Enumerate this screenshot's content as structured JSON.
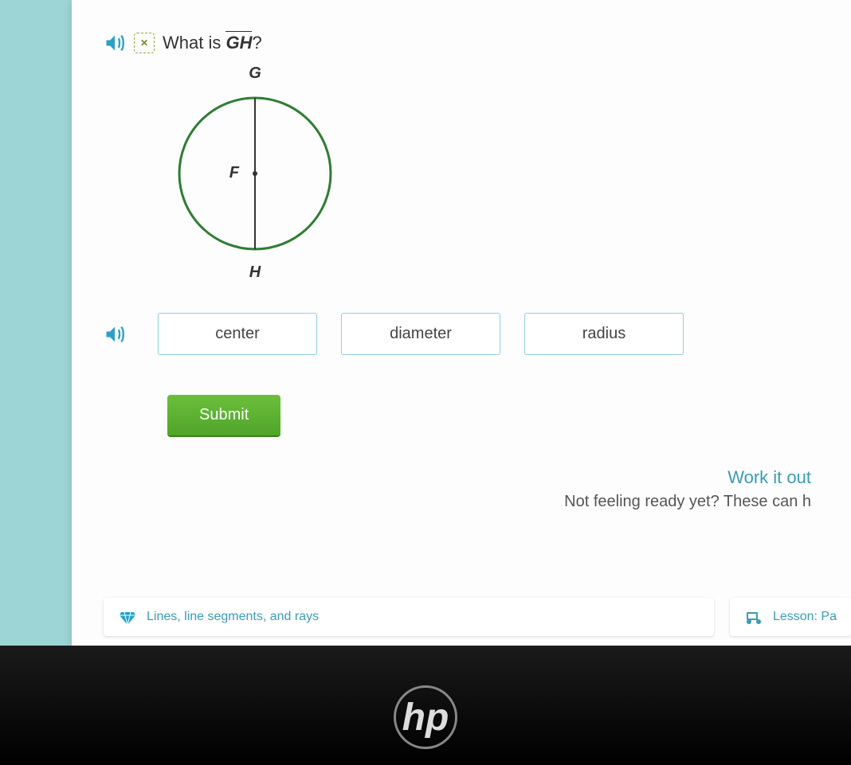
{
  "question": {
    "prefix": "What is ",
    "segment": "GH",
    "suffix": "?"
  },
  "diagram": {
    "labels": {
      "top": "G",
      "center": "F",
      "bottom": "H"
    }
  },
  "answers": [
    "center",
    "diameter",
    "radius"
  ],
  "submit_label": "Submit",
  "work_it_out": {
    "title": "Work it out",
    "subtitle": "Not feeling ready yet? These can h"
  },
  "related": {
    "first": "Lines, line segments, and rays",
    "second": "Lesson: Pa"
  },
  "brand": "hp"
}
